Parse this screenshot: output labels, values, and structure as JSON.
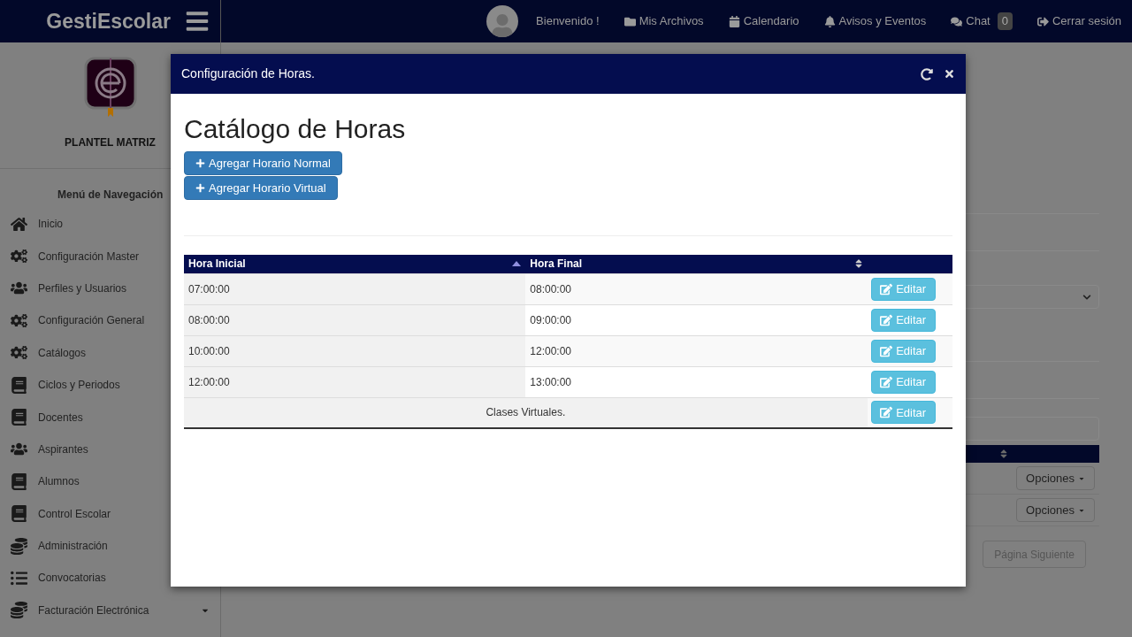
{
  "brand": "GestiEscolar",
  "topnav": [
    {
      "label": "Bienvenido !"
    },
    {
      "label": "Mis Archivos"
    },
    {
      "label": "Calendario"
    },
    {
      "label": "Avisos y Eventos"
    },
    {
      "label": "Chat",
      "badge": "0"
    },
    {
      "label": "Cerrar sesión"
    }
  ],
  "sidebar": {
    "campus": "PLANTEL MATRIZ",
    "menu_title": "Menú de Navegación",
    "items": [
      {
        "label": "Inicio"
      },
      {
        "label": "Configuración Master"
      },
      {
        "label": "Perfiles y Usuarios"
      },
      {
        "label": "Configuración General"
      },
      {
        "label": "Catálogos"
      },
      {
        "label": "Ciclos y Periodos"
      },
      {
        "label": "Docentes"
      },
      {
        "label": "Aspirantes"
      },
      {
        "label": "Alumnos"
      },
      {
        "label": "Control Escolar"
      },
      {
        "label": "Administración"
      },
      {
        "label": "Convocatorias"
      },
      {
        "label": "Facturación Electrónica",
        "expandable": true
      }
    ]
  },
  "background": {
    "options_buttons": [
      "Opciones",
      "Opciones"
    ],
    "next_page": "Página Siguiente"
  },
  "modal": {
    "title": "Configuración de Horas.",
    "heading": "Catálogo de Horas",
    "buttons": [
      "Agregar Horario Normal",
      "Agregar Horario Virtual"
    ],
    "table": {
      "columns": [
        {
          "label": "Hora Inicial",
          "sorted": true
        },
        {
          "label": "Hora Final",
          "sorted": false
        }
      ],
      "rows": [
        {
          "kind": "time",
          "start": "07:00:00",
          "end": "08:00:00",
          "action": "Editar"
        },
        {
          "kind": "time",
          "start": "08:00:00",
          "end": "09:00:00",
          "action": "Editar"
        },
        {
          "kind": "time",
          "start": "10:00:00",
          "end": "12:00:00",
          "action": "Editar"
        },
        {
          "kind": "time",
          "start": "12:00:00",
          "end": "13:00:00",
          "action": "Editar"
        },
        {
          "kind": "virtual",
          "text": "Clases Virtuales.",
          "action": "Editar"
        }
      ]
    }
  }
}
